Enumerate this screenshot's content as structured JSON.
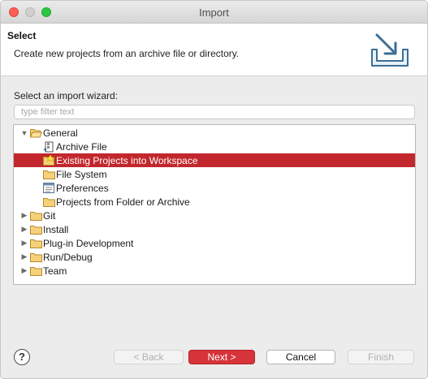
{
  "window": {
    "title": "Import"
  },
  "banner": {
    "title": "Select",
    "description": "Create new projects from an archive file or directory.",
    "icon": "import-tray-icon"
  },
  "wizard": {
    "label": "Select an import wizard:",
    "filter_placeholder": "type filter text",
    "filter_value": ""
  },
  "tree": [
    {
      "label": "General",
      "expanded": true,
      "icon": "folder-open-icon",
      "level": 0
    },
    {
      "label": "Archive File",
      "icon": "archive-file-icon",
      "level": 1
    },
    {
      "label": "Existing Projects into Workspace",
      "icon": "existing-projects-icon",
      "level": 1,
      "selected": true
    },
    {
      "label": "File System",
      "icon": "folder-icon",
      "level": 1
    },
    {
      "label": "Preferences",
      "icon": "preferences-icon",
      "level": 1
    },
    {
      "label": "Projects from Folder or Archive",
      "icon": "folder-icon",
      "level": 1
    },
    {
      "label": "Git",
      "expanded": false,
      "icon": "folder-icon",
      "level": 0
    },
    {
      "label": "Install",
      "expanded": false,
      "icon": "folder-icon",
      "level": 0
    },
    {
      "label": "Plug-in Development",
      "expanded": false,
      "icon": "folder-icon",
      "level": 0
    },
    {
      "label": "Run/Debug",
      "expanded": false,
      "icon": "folder-icon",
      "level": 0
    },
    {
      "label": "Team",
      "expanded": false,
      "icon": "folder-icon",
      "level": 0
    }
  ],
  "buttons": {
    "help": "?",
    "back": "< Back",
    "next": "Next >",
    "cancel": "Cancel",
    "finish": "Finish"
  },
  "colors": {
    "selection": "#c2272d",
    "primary_button": "#d6343a"
  }
}
